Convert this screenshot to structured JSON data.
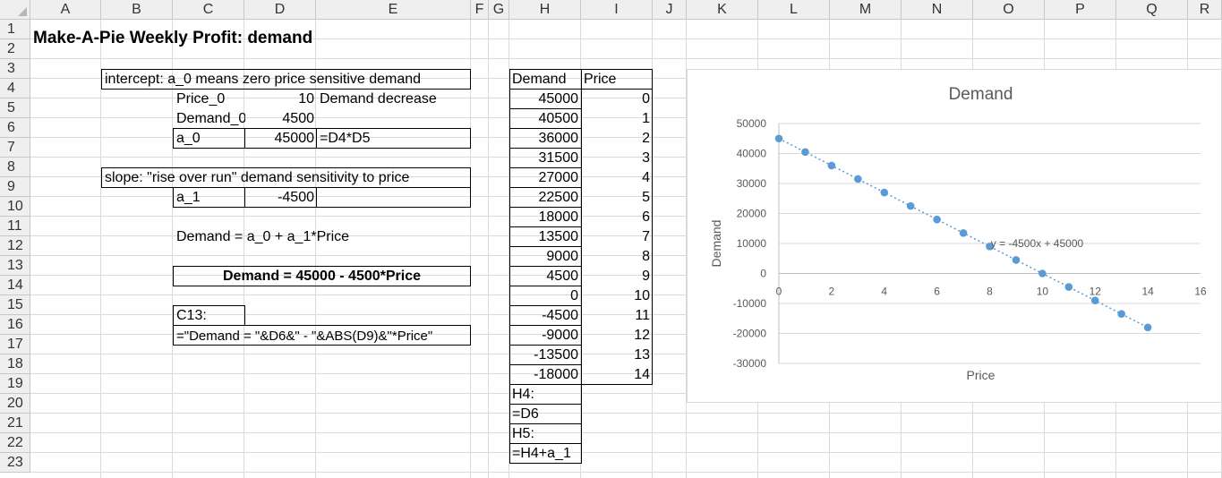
{
  "columns": [
    "A",
    "B",
    "C",
    "D",
    "E",
    "F",
    "G",
    "H",
    "I",
    "J",
    "K",
    "L",
    "M",
    "N",
    "O",
    "P",
    "Q",
    "R"
  ],
  "rows": [
    "1",
    "2",
    "3",
    "4",
    "5",
    "6",
    "7",
    "8",
    "9",
    "10",
    "11",
    "12",
    "13",
    "14",
    "15",
    "16",
    "17",
    "18",
    "19",
    "20",
    "21",
    "22",
    "23"
  ],
  "sheet": {
    "title": "Make-A-Pie Weekly Profit: demand",
    "intercept_note": "intercept: a_0 means zero price sensitive demand",
    "price0_label": "Price_0",
    "price0_value": "10",
    "demand_decrease_label": "Demand decrease",
    "demand0_label": "Demand_0",
    "demand0_value": "4500",
    "a0_label": "a_0",
    "a0_value": "45000",
    "a0_formula": "=D4*D5",
    "slope_note": "slope: \"rise over run\" demand sensitivity to price",
    "a1_label": "a_1",
    "a1_value": "-4500",
    "demand_eq": "Demand = a_0 + a_1*Price",
    "demand_result": "Demand = 45000 -  4500*Price",
    "c13_label": "C13:",
    "c13_formula": "=\"Demand = \"&D6&\" -  \"&ABS(D9)&\"*Price\""
  },
  "table": {
    "headers": [
      "Demand",
      "Price"
    ],
    "rows": [
      [
        "45000",
        "0"
      ],
      [
        "40500",
        "1"
      ],
      [
        "36000",
        "2"
      ],
      [
        "31500",
        "3"
      ],
      [
        "27000",
        "4"
      ],
      [
        "22500",
        "5"
      ],
      [
        "18000",
        "6"
      ],
      [
        "13500",
        "7"
      ],
      [
        "9000",
        "8"
      ],
      [
        "4500",
        "9"
      ],
      [
        "0",
        "10"
      ],
      [
        "-4500",
        "11"
      ],
      [
        "-9000",
        "12"
      ],
      [
        "-13500",
        "13"
      ],
      [
        "-18000",
        "14"
      ]
    ],
    "notes": [
      "H4:",
      "=D6",
      "H5:",
      "=H4+a_1"
    ]
  },
  "chart_data": {
    "type": "scatter",
    "title": "Demand",
    "xlabel": "Price",
    "ylabel": "Demand",
    "xlim": [
      0,
      16
    ],
    "ylim": [
      -30000,
      50000
    ],
    "xticks": [
      0,
      2,
      4,
      6,
      8,
      10,
      12,
      14,
      16
    ],
    "yticks": [
      50000,
      40000,
      30000,
      20000,
      10000,
      0,
      -10000,
      -20000,
      -30000
    ],
    "x": [
      0,
      1,
      2,
      3,
      4,
      5,
      6,
      7,
      8,
      9,
      10,
      11,
      12,
      13,
      14
    ],
    "y": [
      45000,
      40500,
      36000,
      31500,
      27000,
      22500,
      18000,
      13500,
      9000,
      4500,
      0,
      -4500,
      -9000,
      -13500,
      -18000
    ],
    "trendline": {
      "label": "y = -4500x + 45000",
      "slope": -4500,
      "intercept": 45000
    },
    "grid": true,
    "colors": {
      "marker": "#5b9bd5",
      "trend": "#5b9bd5",
      "axis_text": "#595959"
    }
  }
}
